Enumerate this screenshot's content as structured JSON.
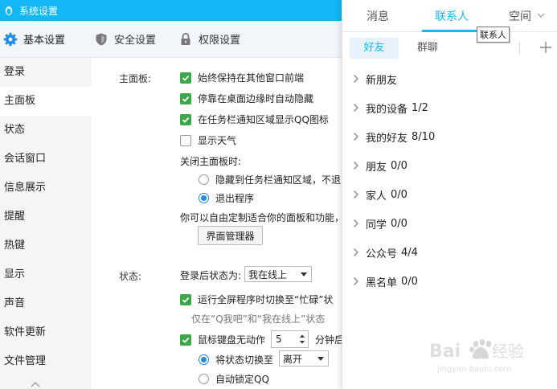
{
  "window": {
    "title": "系统设置"
  },
  "topnav": [
    {
      "label": "基本设置",
      "icon": "gear-icon"
    },
    {
      "label": "安全设置",
      "icon": "shield-icon"
    },
    {
      "label": "权限设置",
      "icon": "lock-icon"
    }
  ],
  "sidebar": {
    "items": [
      "登录",
      "主面板",
      "状态",
      "会话窗口",
      "信息展示",
      "提醒",
      "热键",
      "显示",
      "声音",
      "软件更新",
      "文件管理"
    ],
    "active_index": 1
  },
  "main_panel": {
    "section_label": "主面板:",
    "options": [
      {
        "label": "始终保持在其他窗口前端",
        "checked": true
      },
      {
        "label": "停靠在桌面边缘时自动隐藏",
        "checked": true
      },
      {
        "label": "在任务栏通知区域显示QQ图标",
        "checked": true
      },
      {
        "label": "显示天气",
        "checked": false
      }
    ],
    "close_label": "关闭主面板时:",
    "close_options": [
      {
        "label": "隐藏到任务栏通知区域，不退",
        "selected": false
      },
      {
        "label": "退出程序",
        "selected": true
      }
    ],
    "customize_text": "你可以自由定制适合你的面板和功能，",
    "manager_button": "界面管理器"
  },
  "status": {
    "section_label": "状态:",
    "after_login_label": "登录后状态为:",
    "after_login_value": "我在线上",
    "fullscreen_option": {
      "label": "运行全屏程序时切换至“忙碌”状",
      "checked": true
    },
    "hint": "仅在“Q我吧”和“我在线上”状态",
    "idle_option": {
      "label": "鼠标键盘无动作",
      "checked": true
    },
    "idle_minutes": "5",
    "idle_suffix": "分钟后",
    "switch_label": "将状态切换至",
    "switch_value": "离开",
    "lock_label": "自动锁定QQ"
  },
  "panel": {
    "tabs": [
      "消息",
      "联系人",
      "空间"
    ],
    "active_tab": 1,
    "tooltip": "联系人",
    "subtabs": [
      "好友",
      "群聊"
    ],
    "active_subtab": 0,
    "groups": [
      {
        "name": "新朋友",
        "count": ""
      },
      {
        "name": "我的设备",
        "count": "1/2"
      },
      {
        "name": "我的好友",
        "count": "8/10"
      },
      {
        "name": "朋友",
        "count": "0/0"
      },
      {
        "name": "家人",
        "count": "0/0"
      },
      {
        "name": "同学",
        "count": "0/0"
      },
      {
        "name": "公众号",
        "count": "4/4"
      },
      {
        "name": "黑名单",
        "count": "0/0"
      }
    ]
  },
  "watermark": {
    "brand": "Baidu经验",
    "url": "jingyan.baidu.com"
  },
  "colors": {
    "accent": "#12b7f5",
    "check": "#3ba64a",
    "radio": "#1e8ce8"
  }
}
